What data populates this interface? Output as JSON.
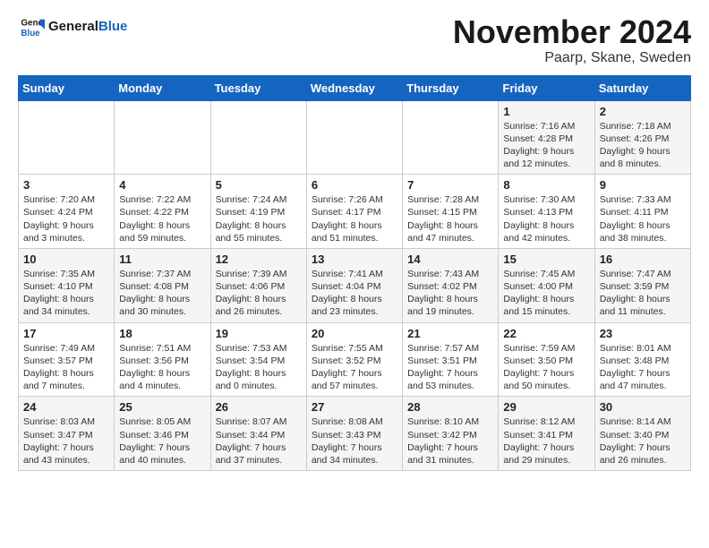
{
  "header": {
    "logo_general": "General",
    "logo_blue": "Blue",
    "title": "November 2024",
    "subtitle": "Paarp, Skane, Sweden"
  },
  "days_of_week": [
    "Sunday",
    "Monday",
    "Tuesday",
    "Wednesday",
    "Thursday",
    "Friday",
    "Saturday"
  ],
  "weeks": [
    [
      {
        "day": "",
        "info": ""
      },
      {
        "day": "",
        "info": ""
      },
      {
        "day": "",
        "info": ""
      },
      {
        "day": "",
        "info": ""
      },
      {
        "day": "",
        "info": ""
      },
      {
        "day": "1",
        "info": "Sunrise: 7:16 AM\nSunset: 4:28 PM\nDaylight: 9 hours\nand 12 minutes."
      },
      {
        "day": "2",
        "info": "Sunrise: 7:18 AM\nSunset: 4:26 PM\nDaylight: 9 hours\nand 8 minutes."
      }
    ],
    [
      {
        "day": "3",
        "info": "Sunrise: 7:20 AM\nSunset: 4:24 PM\nDaylight: 9 hours\nand 3 minutes."
      },
      {
        "day": "4",
        "info": "Sunrise: 7:22 AM\nSunset: 4:22 PM\nDaylight: 8 hours\nand 59 minutes."
      },
      {
        "day": "5",
        "info": "Sunrise: 7:24 AM\nSunset: 4:19 PM\nDaylight: 8 hours\nand 55 minutes."
      },
      {
        "day": "6",
        "info": "Sunrise: 7:26 AM\nSunset: 4:17 PM\nDaylight: 8 hours\nand 51 minutes."
      },
      {
        "day": "7",
        "info": "Sunrise: 7:28 AM\nSunset: 4:15 PM\nDaylight: 8 hours\nand 47 minutes."
      },
      {
        "day": "8",
        "info": "Sunrise: 7:30 AM\nSunset: 4:13 PM\nDaylight: 8 hours\nand 42 minutes."
      },
      {
        "day": "9",
        "info": "Sunrise: 7:33 AM\nSunset: 4:11 PM\nDaylight: 8 hours\nand 38 minutes."
      }
    ],
    [
      {
        "day": "10",
        "info": "Sunrise: 7:35 AM\nSunset: 4:10 PM\nDaylight: 8 hours\nand 34 minutes."
      },
      {
        "day": "11",
        "info": "Sunrise: 7:37 AM\nSunset: 4:08 PM\nDaylight: 8 hours\nand 30 minutes."
      },
      {
        "day": "12",
        "info": "Sunrise: 7:39 AM\nSunset: 4:06 PM\nDaylight: 8 hours\nand 26 minutes."
      },
      {
        "day": "13",
        "info": "Sunrise: 7:41 AM\nSunset: 4:04 PM\nDaylight: 8 hours\nand 23 minutes."
      },
      {
        "day": "14",
        "info": "Sunrise: 7:43 AM\nSunset: 4:02 PM\nDaylight: 8 hours\nand 19 minutes."
      },
      {
        "day": "15",
        "info": "Sunrise: 7:45 AM\nSunset: 4:00 PM\nDaylight: 8 hours\nand 15 minutes."
      },
      {
        "day": "16",
        "info": "Sunrise: 7:47 AM\nSunset: 3:59 PM\nDaylight: 8 hours\nand 11 minutes."
      }
    ],
    [
      {
        "day": "17",
        "info": "Sunrise: 7:49 AM\nSunset: 3:57 PM\nDaylight: 8 hours\nand 7 minutes."
      },
      {
        "day": "18",
        "info": "Sunrise: 7:51 AM\nSunset: 3:56 PM\nDaylight: 8 hours\nand 4 minutes."
      },
      {
        "day": "19",
        "info": "Sunrise: 7:53 AM\nSunset: 3:54 PM\nDaylight: 8 hours\nand 0 minutes."
      },
      {
        "day": "20",
        "info": "Sunrise: 7:55 AM\nSunset: 3:52 PM\nDaylight: 7 hours\nand 57 minutes."
      },
      {
        "day": "21",
        "info": "Sunrise: 7:57 AM\nSunset: 3:51 PM\nDaylight: 7 hours\nand 53 minutes."
      },
      {
        "day": "22",
        "info": "Sunrise: 7:59 AM\nSunset: 3:50 PM\nDaylight: 7 hours\nand 50 minutes."
      },
      {
        "day": "23",
        "info": "Sunrise: 8:01 AM\nSunset: 3:48 PM\nDaylight: 7 hours\nand 47 minutes."
      }
    ],
    [
      {
        "day": "24",
        "info": "Sunrise: 8:03 AM\nSunset: 3:47 PM\nDaylight: 7 hours\nand 43 minutes."
      },
      {
        "day": "25",
        "info": "Sunrise: 8:05 AM\nSunset: 3:46 PM\nDaylight: 7 hours\nand 40 minutes."
      },
      {
        "day": "26",
        "info": "Sunrise: 8:07 AM\nSunset: 3:44 PM\nDaylight: 7 hours\nand 37 minutes."
      },
      {
        "day": "27",
        "info": "Sunrise: 8:08 AM\nSunset: 3:43 PM\nDaylight: 7 hours\nand 34 minutes."
      },
      {
        "day": "28",
        "info": "Sunrise: 8:10 AM\nSunset: 3:42 PM\nDaylight: 7 hours\nand 31 minutes."
      },
      {
        "day": "29",
        "info": "Sunrise: 8:12 AM\nSunset: 3:41 PM\nDaylight: 7 hours\nand 29 minutes."
      },
      {
        "day": "30",
        "info": "Sunrise: 8:14 AM\nSunset: 3:40 PM\nDaylight: 7 hours\nand 26 minutes."
      }
    ]
  ]
}
